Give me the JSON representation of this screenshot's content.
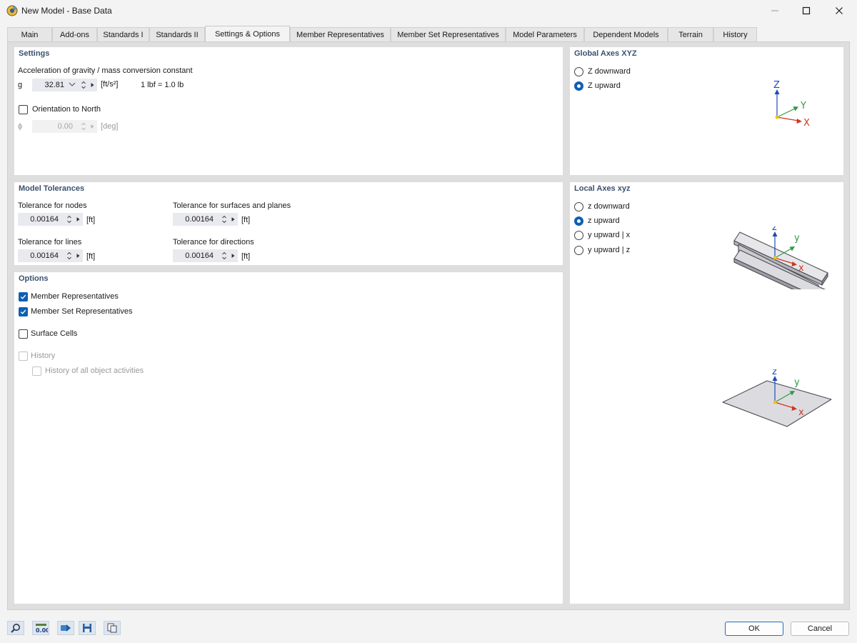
{
  "window": {
    "title": "New Model - Base Data"
  },
  "tabs": [
    "Main",
    "Add-ons",
    "Standards I",
    "Standards II",
    "Settings & Options",
    "Member Representatives",
    "Member Set Representatives",
    "Model Parameters",
    "Dependent Models",
    "Terrain",
    "History"
  ],
  "active_tab": "Settings & Options",
  "settings": {
    "title": "Settings",
    "gravity_label": "Acceleration of gravity / mass conversion constant",
    "g_symbol": "g",
    "g_value": "32.81",
    "g_unit": "[ft/s²]",
    "lbf_note": "1 lbf = 1.0 lb",
    "orientation_label": "Orientation to North",
    "orientation_checked": false,
    "phi_symbol": "ϕ",
    "phi_value": "0.00",
    "phi_unit": "[deg]"
  },
  "global_axes": {
    "title": "Global Axes XYZ",
    "options": [
      {
        "label": "Z downward",
        "selected": false
      },
      {
        "label": "Z upward",
        "selected": true
      }
    ],
    "axis_labels": {
      "z": "Z",
      "y": "Y",
      "x": "X"
    }
  },
  "tolerances": {
    "title": "Model Tolerances",
    "nodes_label": "Tolerance for nodes",
    "nodes_value": "0.00164",
    "surfaces_label": "Tolerance for surfaces and planes",
    "surfaces_value": "0.00164",
    "lines_label": "Tolerance for lines",
    "lines_value": "0.00164",
    "directions_label": "Tolerance for directions",
    "directions_value": "0.00164",
    "unit": "[ft]"
  },
  "local_axes": {
    "title": "Local Axes xyz",
    "options": [
      {
        "label": "z downward",
        "selected": false
      },
      {
        "label": "z upward",
        "selected": true
      },
      {
        "label": "y upward | x",
        "selected": false
      },
      {
        "label": "y upward | z",
        "selected": false
      }
    ],
    "axis_labels": {
      "z": "z",
      "y": "y",
      "x": "x"
    }
  },
  "options": {
    "title": "Options",
    "member_representatives": {
      "label": "Member Representatives",
      "checked": true
    },
    "member_set_representatives": {
      "label": "Member Set Representatives",
      "checked": true
    },
    "surface_cells": {
      "label": "Surface Cells",
      "checked": false
    },
    "history": {
      "label": "History",
      "checked": false,
      "enabled": false
    },
    "history_all": {
      "label": "History of all object activities",
      "checked": false,
      "enabled": false
    }
  },
  "buttons": {
    "ok": "OK",
    "cancel": "Cancel"
  },
  "toolbar": {
    "units_icon_text": "0.00"
  },
  "colors": {
    "accent": "#0f5fb3",
    "section_title": "#3b5170",
    "axis_x": "#d0351c",
    "axis_y": "#2e9a45",
    "axis_z": "#2049b8",
    "origin": "#f2c200"
  }
}
